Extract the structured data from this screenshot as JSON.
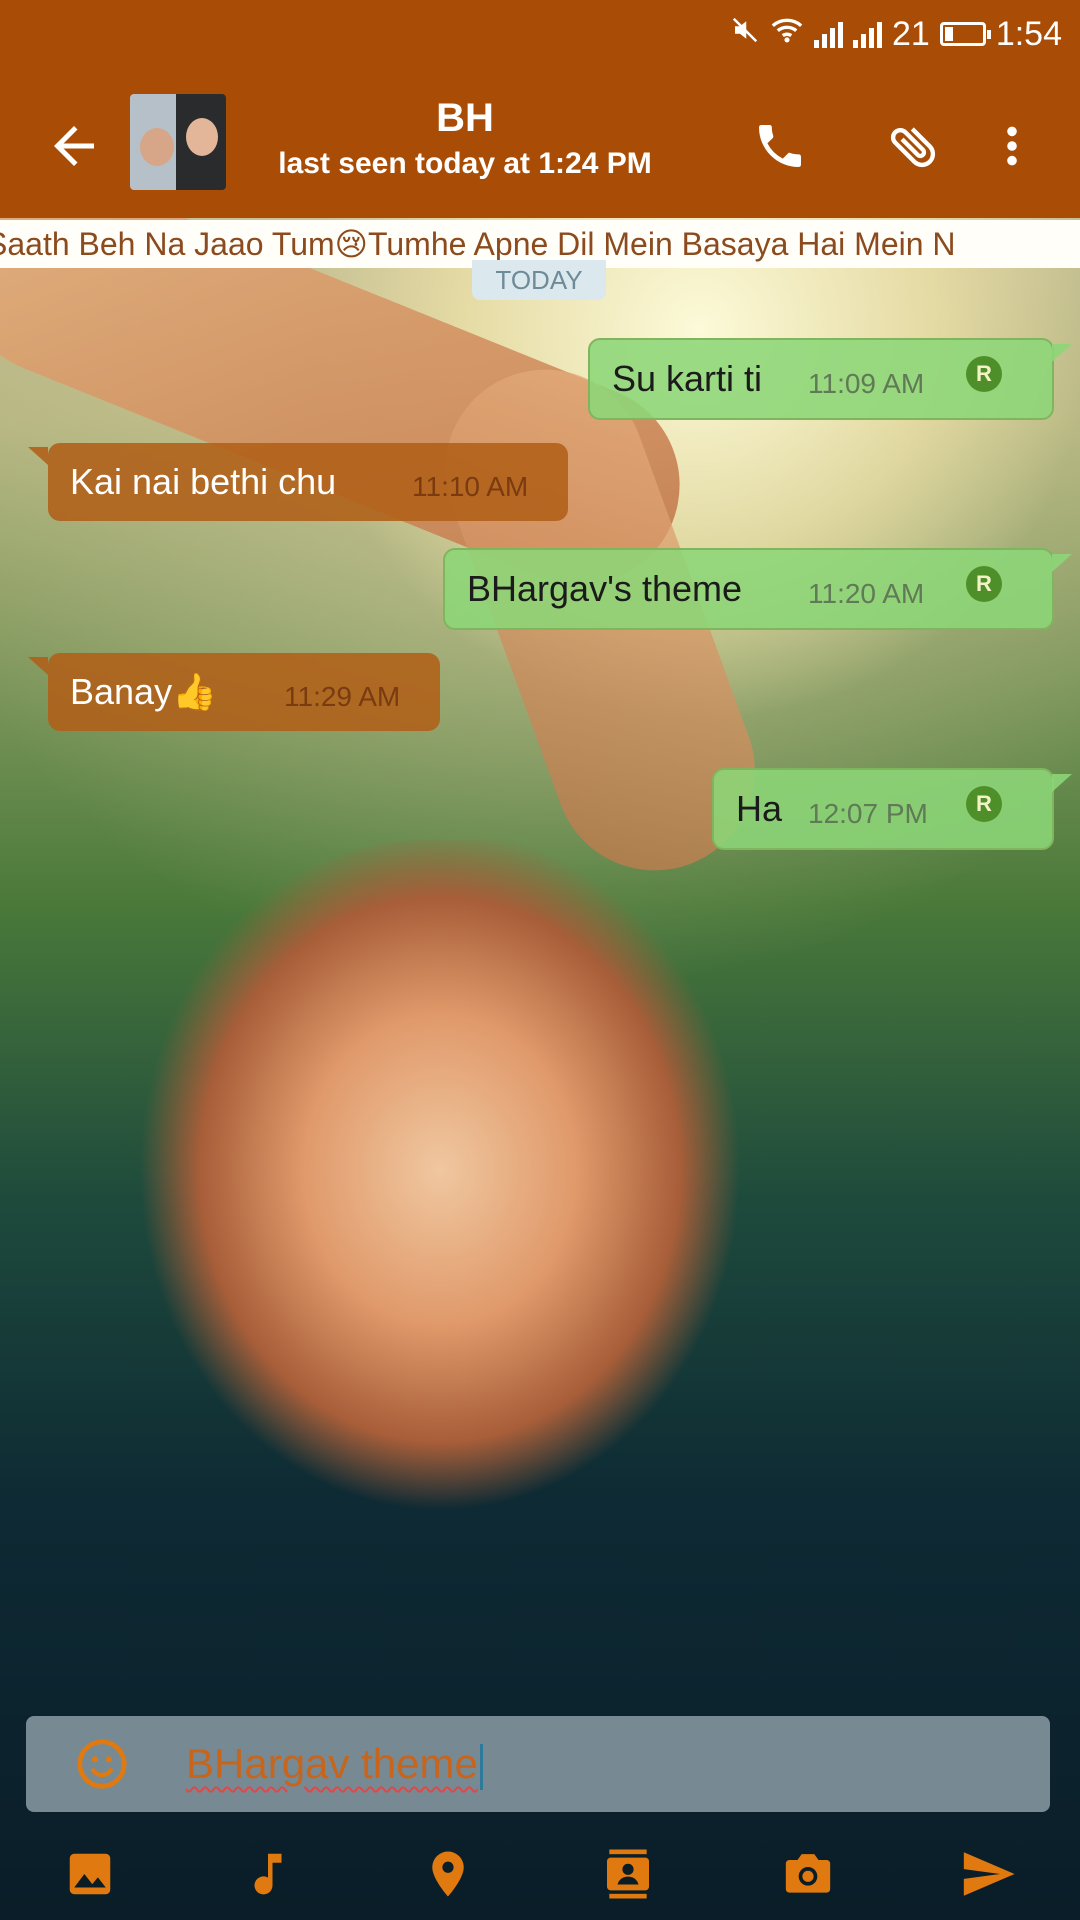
{
  "status_bar": {
    "signal_1": "",
    "signal_label": "21",
    "time": "1:54"
  },
  "header": {
    "contact_name": "BH",
    "last_seen": "last seen today at 1:24 PM"
  },
  "ticker": {
    "text": "Saath Beh Na Jaao Tum😢Tumhe Apne Dil Mein Basaya Hai Mein N"
  },
  "date_chip": "TODAY",
  "messages": [
    {
      "direction": "out",
      "text": "Su karti ti",
      "time": "11:09 AM",
      "badge": "R"
    },
    {
      "direction": "in",
      "text": "Kai nai bethi chu",
      "time": "11:10 AM"
    },
    {
      "direction": "out",
      "text": "BHargav's theme",
      "time": "11:20 AM",
      "badge": "R"
    },
    {
      "direction": "in",
      "text": "Banay👍",
      "time": "11:29 AM"
    },
    {
      "direction": "out",
      "text": "Ha",
      "time": "12:07 PM",
      "badge": "R"
    }
  ],
  "compose": {
    "value": "BHargav theme"
  },
  "colors": {
    "app_bar": "#a94d06",
    "outgoing_bubble": "#8cd678",
    "incoming_bubble": "#b06018",
    "accent_icon": "#e07a10"
  },
  "icons": {
    "back": "arrow-left",
    "call": "phone",
    "attach": "paperclip",
    "menu": "more-vertical",
    "emoji": "smile",
    "gallery": "image",
    "audio": "music-note",
    "location": "map-pin",
    "contact": "contact-card",
    "camera": "camera",
    "send": "send"
  }
}
